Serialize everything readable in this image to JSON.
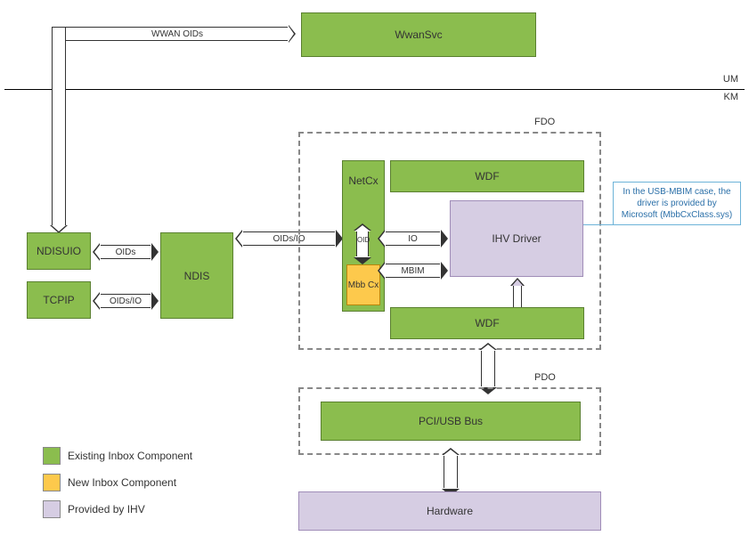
{
  "top": {
    "wwan_oids_label": "WWAN OIDs",
    "wwansvc_label": "WwanSvc"
  },
  "mode_divider": {
    "um_label": "UM",
    "km_label": "KM"
  },
  "left_stack": {
    "ndisuio_label": "NDISUIO",
    "tcpip_label": "TCPIP",
    "ndis_label": "NDIS",
    "oids_arrow_label": "OIDs",
    "oids_io_arrow_label": "OIDs/IO"
  },
  "fdo": {
    "caption": "FDO",
    "netcx_label": "NetCx",
    "wdf_top_label": "WDF",
    "wdf_bottom_label": "WDF",
    "mbbcx_label": "Mbb Cx",
    "ihv_driver_label": "IHV Driver",
    "oids_io_arrow_label": "OIDs/IO",
    "io_arrow_label": "IO",
    "oid_arrow_label": "OID",
    "mbim_arrow_label": "MBIM"
  },
  "pdo": {
    "caption": "PDO",
    "bus_label": "PCI/USB Bus"
  },
  "hardware": {
    "label": "Hardware"
  },
  "callout": {
    "text": "In the USB-MBIM case, the driver is provided by Microsoft (MbbCxClass.sys)"
  },
  "legend": {
    "existing_label": "Existing Inbox Component",
    "new_label": "New Inbox Component",
    "ihv_label": "Provided by IHV"
  },
  "colors": {
    "green": "#8bbd4e",
    "yellow": "#fdc94c",
    "purple": "#d6cde3"
  }
}
